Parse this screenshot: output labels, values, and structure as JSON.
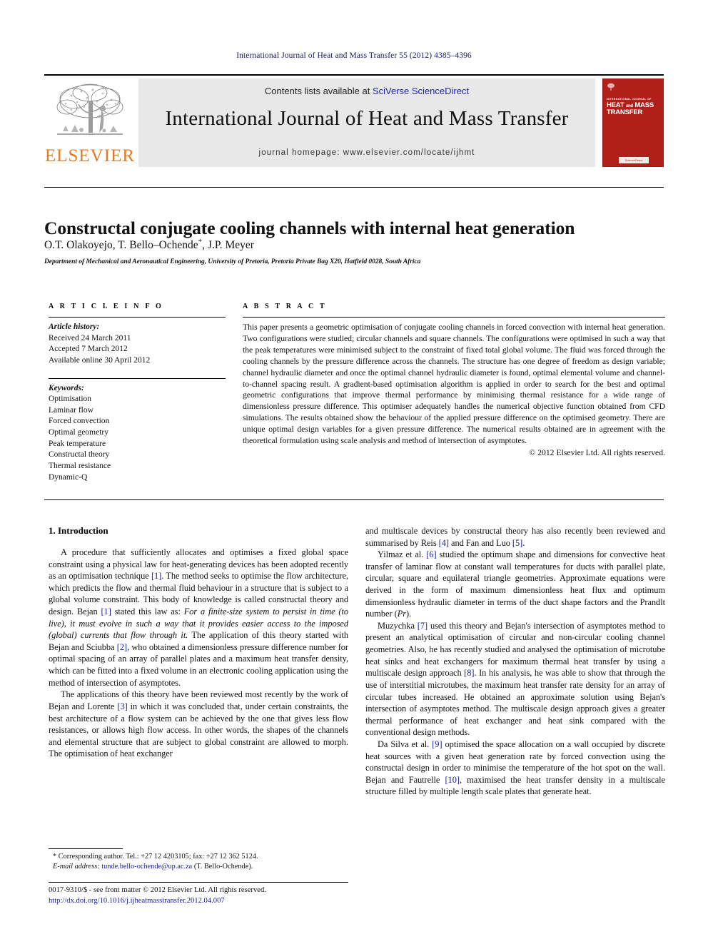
{
  "running_head": "International Journal of Heat and Mass Transfer 55 (2012) 4385–4396",
  "banner": {
    "contents_prefix": "Contents lists available at ",
    "sciencedirect": "SciVerse ScienceDirect",
    "journal_title": "International Journal of Heat and Mass Transfer",
    "homepage": "journal homepage: www.elsevier.com/locate/ijhmt",
    "publisher_wordmark": "ELSEVIER",
    "publisher_color": "#E87722",
    "link_color": "#2222aa",
    "cover": {
      "kicker": "INTERNATIONAL JOURNAL OF",
      "line1": "HEAT",
      "and": "and",
      "line2": "MASS",
      "line3": "TRANSFER",
      "footer": "ScienceDirect",
      "background_color": "#b01f19"
    }
  },
  "article": {
    "title": "Constructal conjugate cooling channels with internal heat generation",
    "authors": "O.T. Olakoyejo, T. Bello–Ochende",
    "authors_star": "*",
    "authors_tail": ", J.P. Meyer",
    "affiliation": "Department of Mechanical and Aeronautical Engineering, University of Pretoria, Pretoria Private Bag X20, Hatfield 0028, South Africa"
  },
  "article_info": {
    "heading": "A R T I C L E   I N F O",
    "history_label": "Article history:",
    "history": [
      "Received 24 March 2011",
      "Accepted 7 March 2012",
      "Available online 30 April 2012"
    ],
    "keywords_label": "Keywords:",
    "keywords": [
      "Optimisation",
      "Laminar flow",
      "Forced convection",
      "Optimal geometry",
      "Peak temperature",
      "Constructal theory",
      "Thermal resistance",
      "Dynamic-Q"
    ]
  },
  "abstract": {
    "heading": "A B S T R A C T",
    "body": "This paper presents a geometric optimisation of conjugate cooling channels in forced convection with internal heat generation. Two configurations were studied; circular channels and square channels. The configurations were optimised in such a way that the peak temperatures were minimised subject to the constraint of fixed total global volume. The fluid was forced through the cooling channels by the pressure difference across the channels. The structure has one degree of freedom as design variable; channel hydraulic diameter and once the optimal channel hydraulic diameter is found, optimal elemental volume and channel-to-channel spacing result. A gradient-based optimisation algorithm is applied in order to search for the best and optimal geometric configurations that improve thermal performance by minimising thermal resistance for a wide range of dimensionless pressure difference. This optimiser adequately handles the numerical objective function obtained from CFD simulations. The results obtained show the behaviour of the applied pressure difference on the optimised geometry. There are unique optimal design variables for a given pressure difference. The numerical results obtained are in agreement with the theoretical formulation using scale analysis and method of intersection of asymptotes.",
    "copyright": "© 2012 Elsevier Ltd. All rights reserved."
  },
  "body": {
    "section_heading": "1. Introduction",
    "left_paragraphs": [
      {
        "indent": true,
        "parts": [
          {
            "t": "A procedure that sufficiently allocates and optimises a fixed global space constraint using a physical law for heat-generating devices has been adopted recently as an optimisation technique ",
            "s": "n"
          },
          {
            "t": "[1]",
            "s": "r"
          },
          {
            "t": ". The method seeks to optimise the flow architecture, which predicts the flow and thermal fluid behaviour in a structure that is subject to a global volume constraint. This body of knowledge is called constructal theory and design. Bejan ",
            "s": "n"
          },
          {
            "t": "[1]",
            "s": "r"
          },
          {
            "t": " stated this law as: ",
            "s": "n"
          },
          {
            "t": "For a finite-size system to persist in time (to live), it must evolve in such a way that it provides easier access to the imposed (global) currents that flow through it.",
            "s": "i"
          },
          {
            "t": " The application of this theory started with Bejan and Sciubba ",
            "s": "n"
          },
          {
            "t": "[2]",
            "s": "r"
          },
          {
            "t": ", who obtained a dimensionless pressure difference number for optimal spacing of an array of parallel plates and a maximum heat transfer density, which can be fitted into a fixed volume in an electronic cooling application using the method of intersection of asymptotes.",
            "s": "n"
          }
        ]
      },
      {
        "indent": true,
        "parts": [
          {
            "t": "The applications of this theory have been reviewed most recently by the work of Bejan and Lorente ",
            "s": "n"
          },
          {
            "t": "[3]",
            "s": "r"
          },
          {
            "t": " in which it was concluded that, under certain constraints, the best architecture of a flow system can be achieved by the one that gives less flow resistances, or allows high flow access. In other words, the shapes of the channels and elemental structure that are subject to global constraint are allowed to morph. The optimisation of heat exchanger",
            "s": "n"
          }
        ]
      }
    ],
    "right_paragraphs": [
      {
        "indent": false,
        "parts": [
          {
            "t": "and multiscale devices by constructal theory has also recently been reviewed and summarised by Reis ",
            "s": "n"
          },
          {
            "t": "[4]",
            "s": "r"
          },
          {
            "t": " and Fan and Luo ",
            "s": "n"
          },
          {
            "t": "[5]",
            "s": "r"
          },
          {
            "t": ".",
            "s": "n"
          }
        ]
      },
      {
        "indent": true,
        "parts": [
          {
            "t": "Yilmaz et al. ",
            "s": "n"
          },
          {
            "t": "[6]",
            "s": "r"
          },
          {
            "t": " studied the optimum shape and dimensions for convective heat transfer of laminar flow at constant wall temperatures for ducts with parallel plate, circular, square and equilateral triangle geometries. Approximate equations were derived in the form of maximum dimensionless heat flux and optimum dimensionless hydraulic diameter in terms of the duct shape factors and the Prandlt number (",
            "s": "n"
          },
          {
            "t": "Pr",
            "s": "i"
          },
          {
            "t": ").",
            "s": "n"
          }
        ]
      },
      {
        "indent": true,
        "parts": [
          {
            "t": "Muzychka ",
            "s": "n"
          },
          {
            "t": "[7]",
            "s": "r"
          },
          {
            "t": " used this theory and Bejan's intersection of asymptotes method to present an analytical optimisation of circular and non-circular cooling channel geometries. Also, he has recently studied and analysed the optimisation of microtube heat sinks and heat exchangers for maximum thermal heat transfer by using a multiscale design approach ",
            "s": "n"
          },
          {
            "t": "[8]",
            "s": "r"
          },
          {
            "t": ". In his analysis, he was able to show that through the use of interstitial microtubes, the maximum heat transfer rate density for an array of circular tubes increased. He obtained an approximate solution using Bejan's intersection of asymptotes method. The multiscale design approach gives a greater thermal performance of heat exchanger and heat sink compared with the conventional design methods.",
            "s": "n"
          }
        ]
      },
      {
        "indent": true,
        "parts": [
          {
            "t": "Da Silva et al. ",
            "s": "n"
          },
          {
            "t": "[9]",
            "s": "r"
          },
          {
            "t": " optimised the space allocation on a wall occupied by discrete heat sources with a given heat generation rate by forced convection using the constructal design in order to minimise the temperature of the hot spot on the wall. Bejan and Fautrelle ",
            "s": "n"
          },
          {
            "t": "[10]",
            "s": "r"
          },
          {
            "t": ", maximised the heat transfer density in a multiscale structure filled by multiple length scale plates that generate heat.",
            "s": "n"
          }
        ]
      }
    ]
  },
  "footnote": {
    "star": "*",
    "line1": "Corresponding author. Tel.: +27 12 4203105; fax: +27 12 362 5124.",
    "email_label": "E-mail address:",
    "email": "tunde.bello-ochende@up.ac.za",
    "email_tail": "(T. Bello-Ochende)."
  },
  "issn_block": {
    "line1": "0017-9310/$ - see front matter © 2012 Elsevier Ltd. All rights reserved.",
    "doi": "http://dx.doi.org/10.1016/j.ijheatmasstransfer.2012.04.007"
  }
}
